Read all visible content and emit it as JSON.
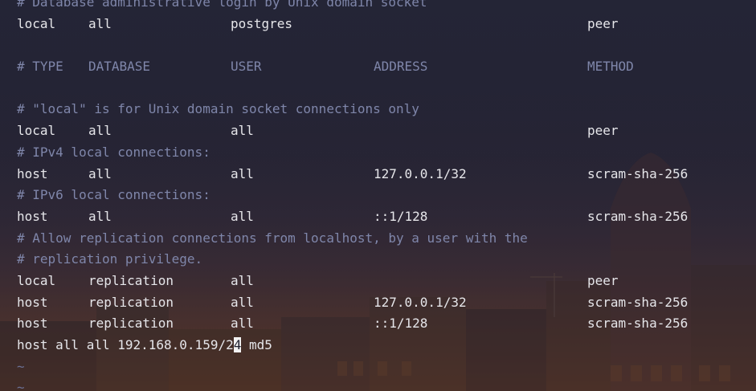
{
  "editor": {
    "lines": [
      {
        "kind": "comment",
        "text": "# Database administrative login by Unix domain socket"
      },
      {
        "kind": "entry",
        "cols": [
          "local",
          "all",
          "postgres",
          "",
          "peer"
        ]
      },
      {
        "kind": "blank"
      },
      {
        "kind": "header",
        "cols": [
          "# TYPE",
          "DATABASE",
          "USER",
          "ADDRESS",
          "METHOD"
        ]
      },
      {
        "kind": "blank"
      },
      {
        "kind": "comment",
        "text": "# \"local\" is for Unix domain socket connections only"
      },
      {
        "kind": "entry",
        "cols": [
          "local",
          "all",
          "all",
          "",
          "peer"
        ]
      },
      {
        "kind": "comment",
        "text": "# IPv4 local connections:"
      },
      {
        "kind": "entry",
        "cols": [
          "host",
          "all",
          "all",
          "127.0.0.1/32",
          "scram-sha-256"
        ]
      },
      {
        "kind": "comment",
        "text": "# IPv6 local connections:"
      },
      {
        "kind": "entry",
        "cols": [
          "host",
          "all",
          "all",
          "::1/128",
          "scram-sha-256"
        ]
      },
      {
        "kind": "comment",
        "text": "# Allow replication connections from localhost, by a user with the"
      },
      {
        "kind": "comment",
        "text": "# replication privilege."
      },
      {
        "kind": "entry",
        "cols": [
          "local",
          "replication",
          "all",
          "",
          "peer"
        ]
      },
      {
        "kind": "entry",
        "cols": [
          "host",
          "replication",
          "all",
          "127.0.0.1/32",
          "scram-sha-256"
        ]
      },
      {
        "kind": "entry",
        "cols": [
          "host",
          "replication",
          "all",
          "::1/128",
          "scram-sha-256"
        ]
      },
      {
        "kind": "cursorline",
        "before": "host all all 192.168.0.159/2",
        "cursor": "4",
        "after": " md5"
      },
      {
        "kind": "tilde",
        "text": "~"
      },
      {
        "kind": "tilde",
        "text": "~"
      }
    ]
  },
  "colors": {
    "comment": "#7f86aa",
    "text": "#e6e6ea",
    "tilde": "#6b7094",
    "cursor_bg": "#f2f2f2"
  }
}
